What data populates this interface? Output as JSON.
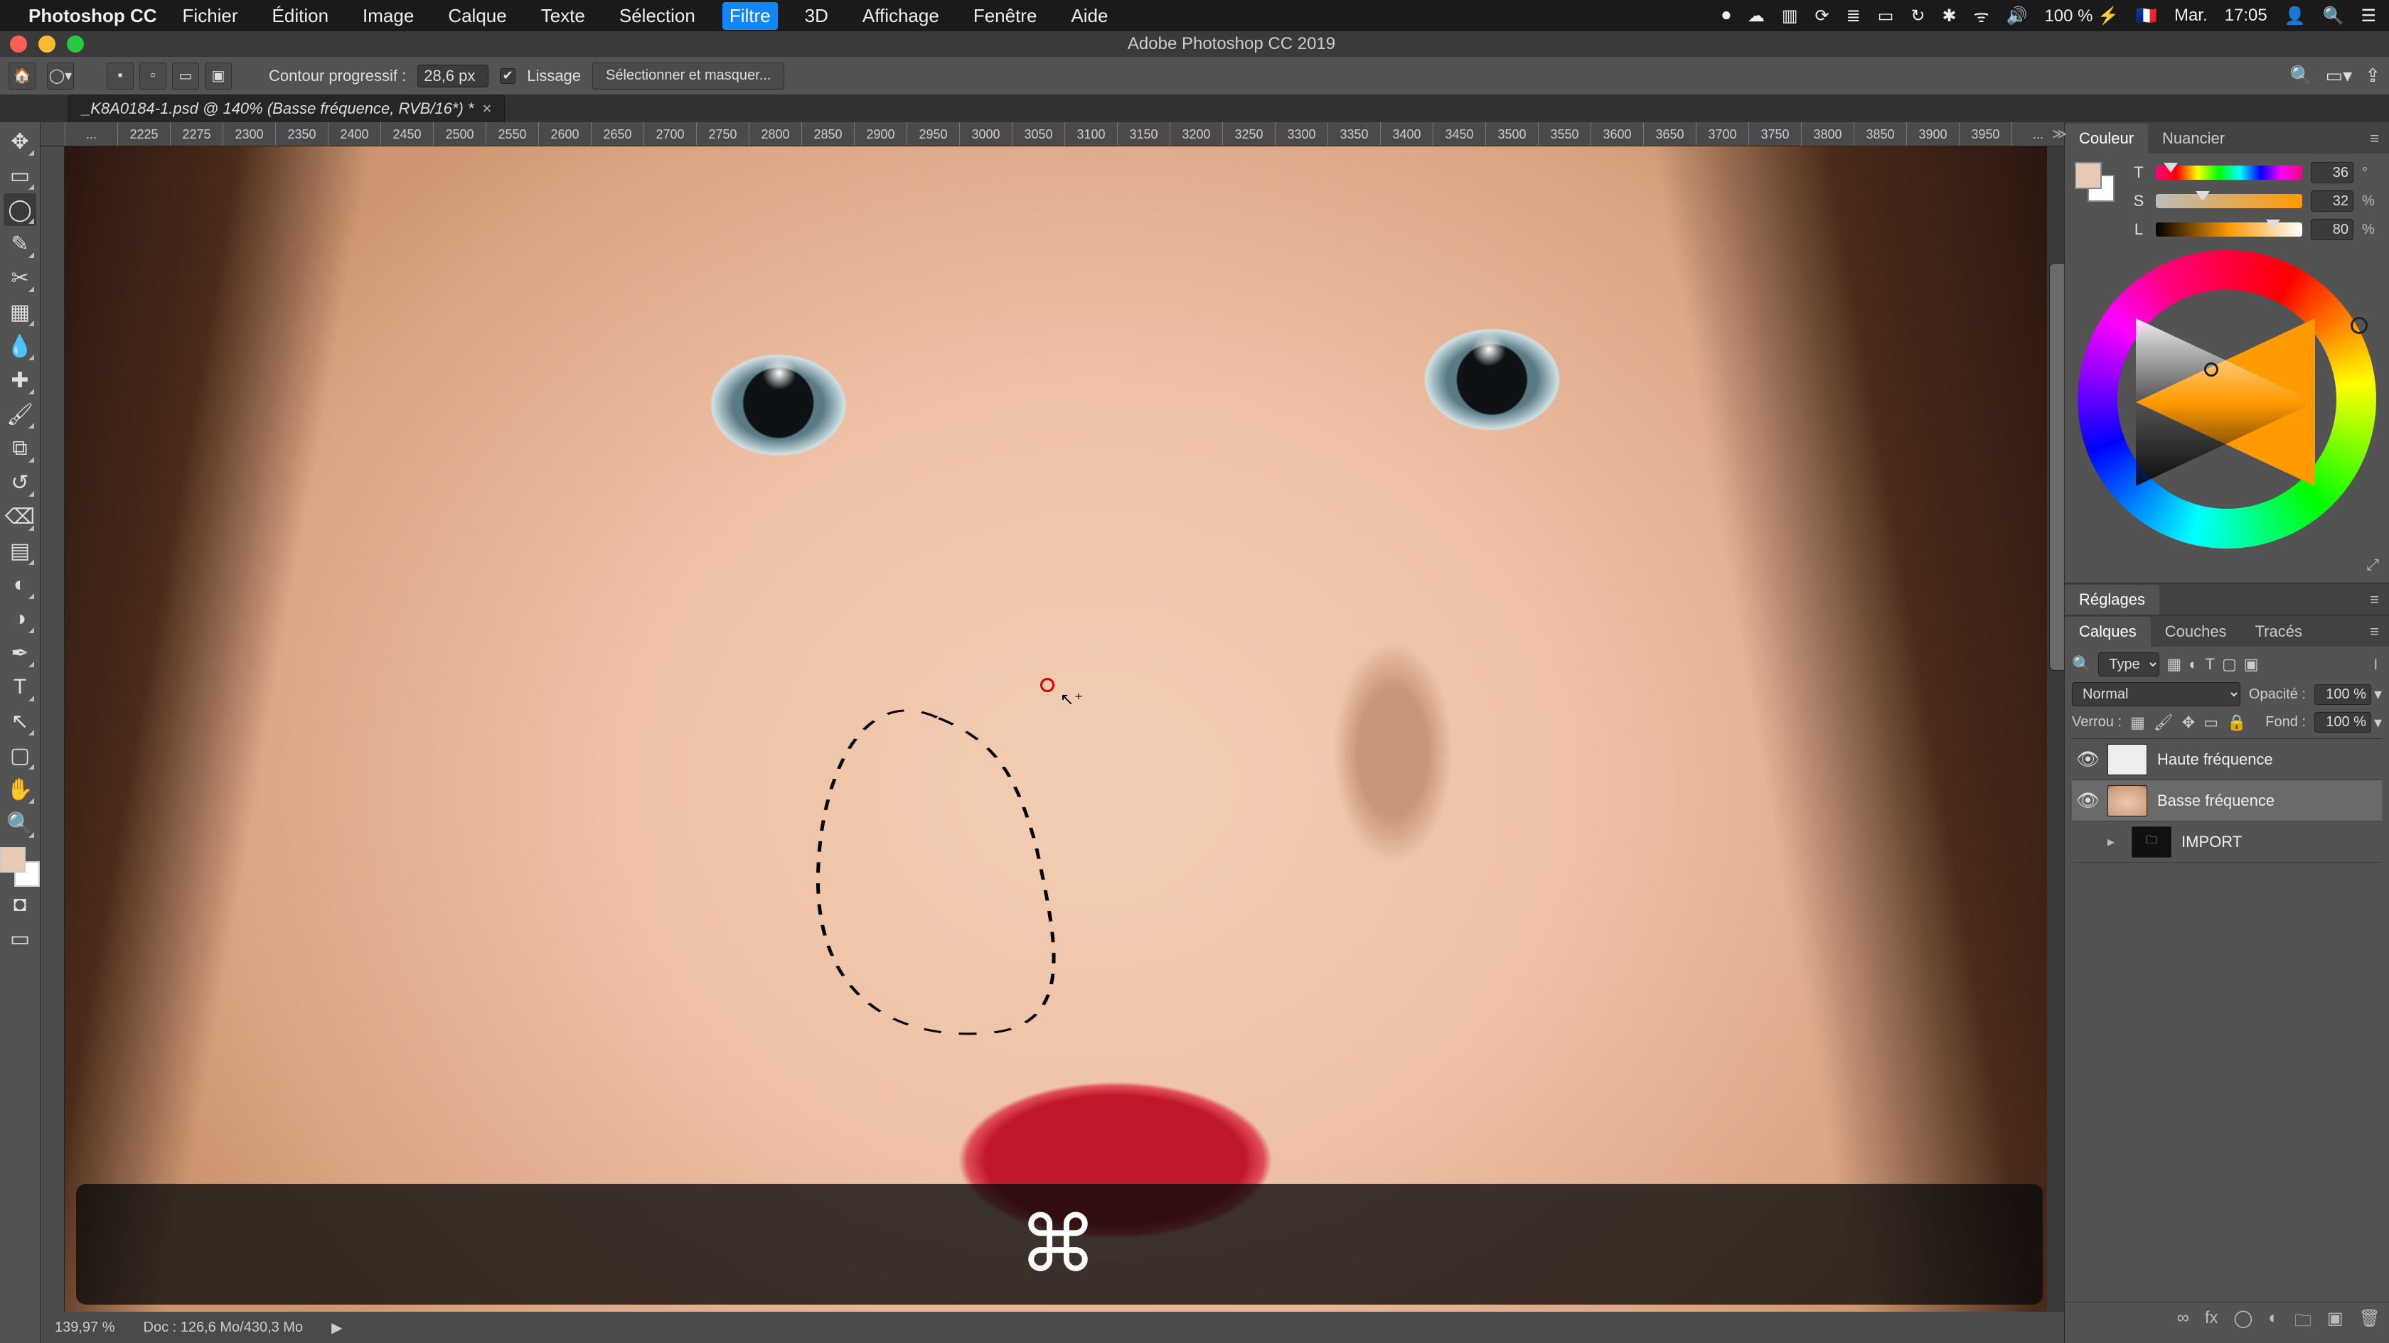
{
  "menubar": {
    "app": "Photoshop CC",
    "items": [
      "Fichier",
      "Édition",
      "Image",
      "Calque",
      "Texte",
      "Sélection",
      "Filtre",
      "3D",
      "Affichage",
      "Fenêtre",
      "Aide"
    ],
    "highlighted_index": 6,
    "status": {
      "battery": "100 % ⚡",
      "flag": "🇫🇷",
      "day": "Mar.",
      "time": "17:05"
    }
  },
  "window": {
    "title": "Adobe Photoshop CC 2019"
  },
  "options": {
    "feather_label": "Contour progressif :",
    "feather_value": "28,6 px",
    "antialias_label": "Lissage",
    "antialias_checked": true,
    "select_mask_label": "Sélectionner et masquer..."
  },
  "document": {
    "tab_title": "_K8A0184-1.psd @ 140% (Basse fréquence, RVB/16*) *"
  },
  "ruler_h": [
    "...",
    "2225",
    "2275",
    "2300",
    "2350",
    "2400",
    "2450",
    "2500",
    "2550",
    "2600",
    "2650",
    "2700",
    "2750",
    "2800",
    "2850",
    "2900",
    "2950",
    "3000",
    "3050",
    "3100",
    "3150",
    "3200",
    "3250",
    "3300",
    "3350",
    "3400",
    "3450",
    "3500",
    "3550",
    "3600",
    "3650",
    "3700",
    "3750",
    "3800",
    "3850",
    "3900",
    "3950",
    "..."
  ],
  "status_left": "139,97 %",
  "status_doc": "Doc : 126,6 Mo/430,3 Mo",
  "key_overlay": "⌘",
  "color_panel": {
    "tabs": [
      "Couleur",
      "Nuancier"
    ],
    "active_tab": 0,
    "mode_labels": [
      "T",
      "S",
      "L"
    ],
    "values": {
      "T": "36",
      "S": "32",
      "L": "80"
    },
    "unit": "%"
  },
  "adjust_panel": {
    "tab": "Réglages"
  },
  "layers_panel": {
    "tabs": [
      "Calques",
      "Couches",
      "Tracés"
    ],
    "active_tab": 0,
    "filter_placeholder": "Type",
    "blend_mode": "Normal",
    "opacity_label": "Opacité :",
    "opacity_value": "100 %",
    "lock_label": "Verrou :",
    "fill_label": "Fond :",
    "fill_value": "100 %",
    "layers": [
      {
        "visible": true,
        "thumb": "white",
        "name": "Haute fréquence",
        "selected": false,
        "group": false
      },
      {
        "visible": true,
        "thumb": "photo",
        "name": "Basse fréquence",
        "selected": true,
        "group": false
      },
      {
        "visible": false,
        "thumb": "folder",
        "name": "IMPORT",
        "selected": false,
        "group": true
      }
    ]
  },
  "tools": [
    {
      "n": "move-tool",
      "g": "✥"
    },
    {
      "n": "marquee-tool",
      "g": "▭"
    },
    {
      "n": "lasso-tool",
      "g": "◯",
      "sel": true
    },
    {
      "n": "quick-select-tool",
      "g": "✎"
    },
    {
      "n": "crop-tool",
      "g": "✂"
    },
    {
      "n": "frame-tool",
      "g": "▦"
    },
    {
      "n": "eyedropper-tool",
      "g": "💧"
    },
    {
      "n": "heal-tool",
      "g": "✚"
    },
    {
      "n": "brush-tool",
      "g": "🖌"
    },
    {
      "n": "stamp-tool",
      "g": "⧉"
    },
    {
      "n": "history-brush-tool",
      "g": "↺"
    },
    {
      "n": "eraser-tool",
      "g": "⌫"
    },
    {
      "n": "gradient-tool",
      "g": "▤"
    },
    {
      "n": "blur-tool",
      "g": "◐"
    },
    {
      "n": "dodge-tool",
      "g": "◑"
    },
    {
      "n": "pen-tool",
      "g": "✒"
    },
    {
      "n": "type-tool",
      "g": "T"
    },
    {
      "n": "path-select-tool",
      "g": "↖"
    },
    {
      "n": "shape-tool",
      "g": "▢"
    },
    {
      "n": "hand-tool",
      "g": "✋"
    },
    {
      "n": "zoom-tool",
      "g": "🔍"
    }
  ]
}
